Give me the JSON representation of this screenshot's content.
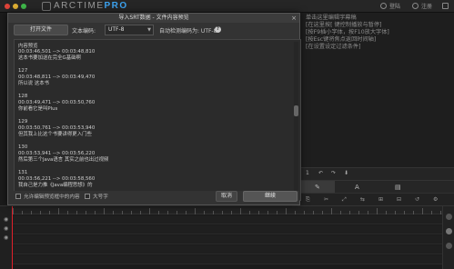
{
  "app": {
    "logo_text": "ARCTIME",
    "logo_pro": "PRO",
    "top_links": [
      "登陆",
      "注册"
    ],
    "brand_color": "#3da3f0"
  },
  "dialog": {
    "title": "导入SRT数据 - 文件内容预览",
    "close_glyph": "×",
    "open_file_label": "打开文件",
    "encoding_label": "文本编码:",
    "encoding_value": "UTF-8",
    "auto_detect_label": "自动检测编码为: UTF-8",
    "help_glyph": "?",
    "preview_label": "内容预览",
    "entries": [
      {
        "time": "00:03:46,501 --> 00:03:48,810",
        "text": "这本书要加送在完全G基础啊"
      },
      {
        "index": "127",
        "time": "00:03:48,811 --> 00:03:49,470",
        "text": "所以说 这本书"
      },
      {
        "index": "128",
        "time": "00:03:49,471 --> 00:03:50,760",
        "text": "你前看它是叫Plus"
      },
      {
        "index": "129",
        "time": "00:03:50,761 --> 00:03:53,940",
        "text": "但其我上比这个书要讲得更入门些"
      },
      {
        "index": "130",
        "time": "00:03:53,941 --> 00:03:56,220",
        "text": "然后第三个Java语言 其实之前也出过视频"
      },
      {
        "index": "131",
        "time": "00:03:56,221 --> 00:03:58,560",
        "text": "我自己是力推《Java编程思想》的"
      }
    ],
    "footer": {
      "option_replace": "允许编辑预览框中的内容",
      "option_uppercase": "大号字",
      "cancel_label": "取消",
      "import_label": "继续"
    }
  },
  "right_panel": {
    "lines": [
      "单击这里编辑字幕稿",
      "[在这里按[ 键控制播放与暂停]",
      "[按F9插小字体，按F10放大字体]",
      "[按Esc键将焦点返回时间轴]",
      "[在设置设定过滤条件]"
    ],
    "toolbar_items": [
      "1",
      "↶",
      "↷",
      "⬇"
    ],
    "tab_glyphs": [
      "✎",
      "A",
      "▤"
    ],
    "sub_glyphs": [
      "⎘",
      "✂",
      "⤢",
      "⇆",
      "⊞",
      "⊟",
      "↺",
      "⚙"
    ]
  },
  "timeline": {
    "track_count": 5
  }
}
